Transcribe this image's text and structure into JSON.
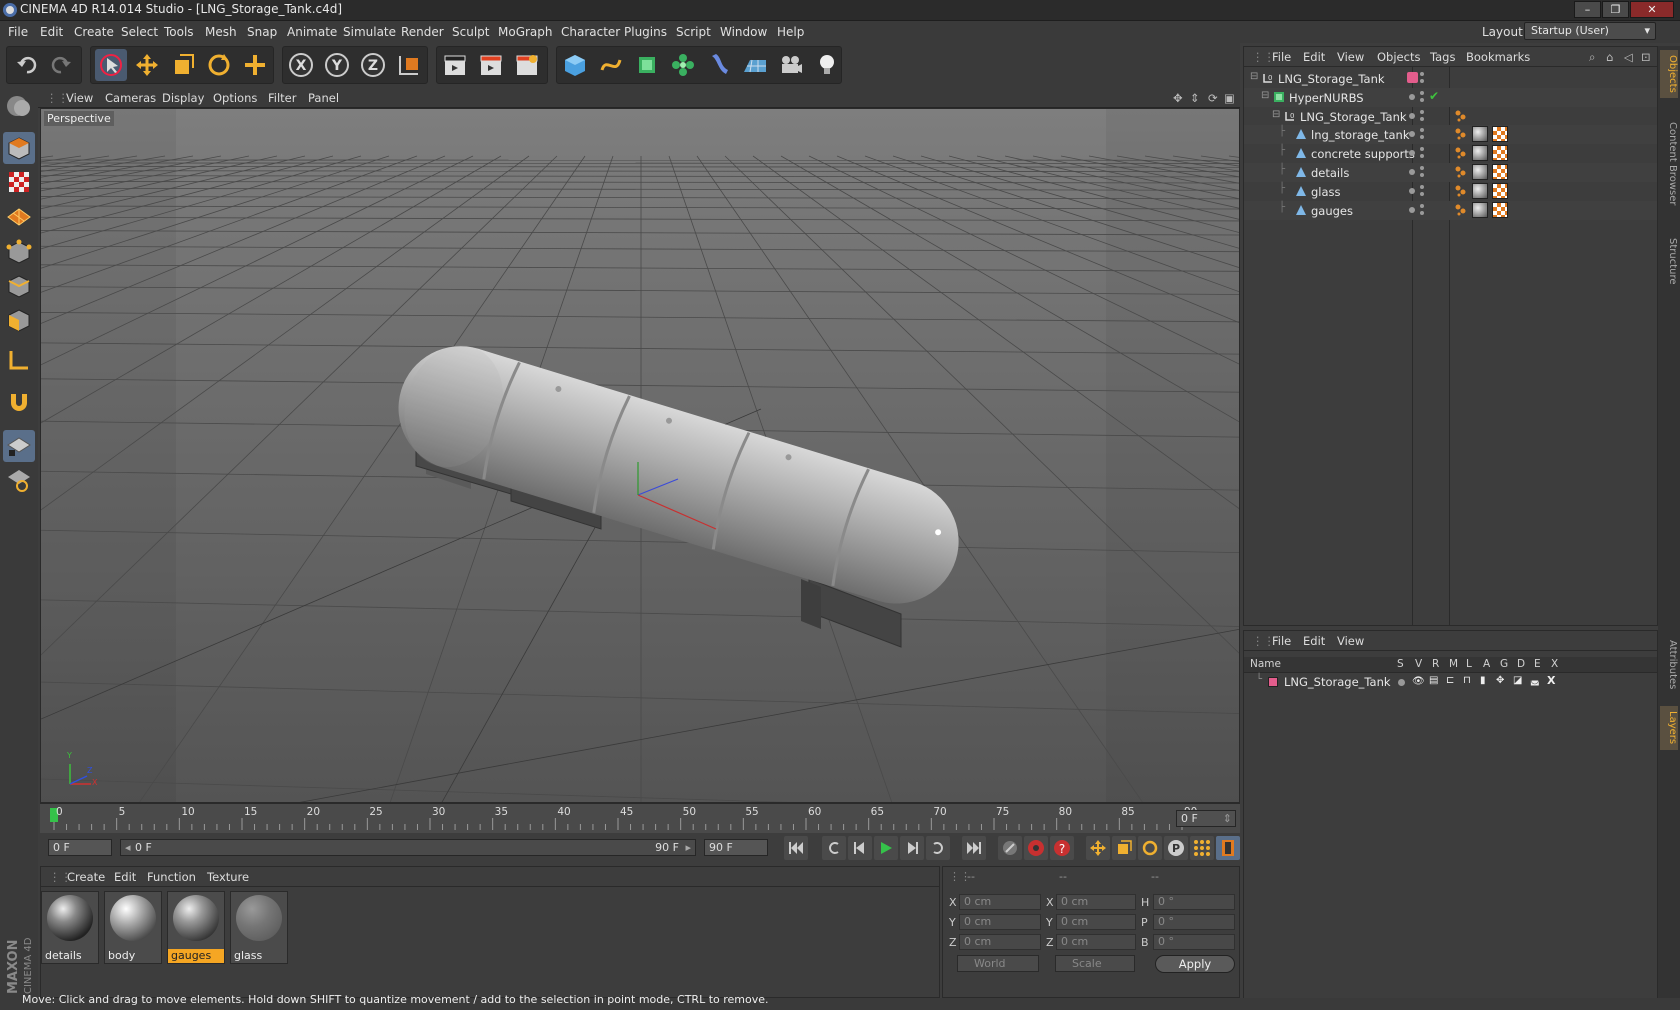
{
  "window": {
    "title": "CINEMA 4D R14.014 Studio - [LNG_Storage_Tank.c4d]",
    "minimize_label": "–",
    "maximize_label": "❐",
    "close_label": "✕"
  },
  "menubar": {
    "items": [
      "File",
      "Edit",
      "Create",
      "Select",
      "Tools",
      "Mesh",
      "Snap",
      "Animate",
      "Simulate",
      "Render",
      "Sculpt",
      "MoGraph",
      "Character",
      "Plugins",
      "Script",
      "Window",
      "Help"
    ],
    "layout_label": "Layout:",
    "layout_value": "Startup (User)"
  },
  "viewport": {
    "menu": [
      "View",
      "Cameras",
      "Display",
      "Options",
      "Filter",
      "Panel"
    ],
    "camera_label": "Perspective",
    "axis_labels": {
      "y": "Y",
      "x": "X",
      "z": "Z"
    }
  },
  "timeline": {
    "ticks": [
      "0",
      "5",
      "10",
      "15",
      "20",
      "25",
      "30",
      "35",
      "40",
      "45",
      "50",
      "55",
      "60",
      "65",
      "70",
      "75",
      "80",
      "85",
      "90"
    ],
    "current_frame": "0 F",
    "start_frame": "0 F",
    "range_start": "0 F",
    "range_end": "90 F",
    "end_frame": "90 F"
  },
  "materials": {
    "menu": [
      "Create",
      "Edit",
      "Function",
      "Texture"
    ],
    "items": [
      {
        "name": "details",
        "selected": false
      },
      {
        "name": "body",
        "selected": false
      },
      {
        "name": "gauges",
        "selected": true
      },
      {
        "name": "glass",
        "selected": false
      }
    ]
  },
  "coordinates": {
    "header": [
      "--",
      "--",
      "--"
    ],
    "rows": [
      {
        "a": "X",
        "av": "0 cm",
        "b": "X",
        "bv": "0 cm",
        "c": "H",
        "cv": "0 °"
      },
      {
        "a": "Y",
        "av": "0 cm",
        "b": "Y",
        "bv": "0 cm",
        "c": "P",
        "cv": "0 °"
      },
      {
        "a": "Z",
        "av": "0 cm",
        "b": "Z",
        "bv": "0 cm",
        "c": "B",
        "cv": "0 °"
      }
    ],
    "mode1": "World",
    "mode2": "Scale",
    "apply_label": "Apply"
  },
  "objects_panel": {
    "menu": [
      "File",
      "Edit",
      "View",
      "Objects",
      "Tags",
      "Bookmarks"
    ],
    "tree": [
      {
        "name": "LNG_Storage_Tank",
        "depth": 0,
        "type": "null"
      },
      {
        "name": "HyperNURBS",
        "depth": 1,
        "type": "nurbs"
      },
      {
        "name": "LNG_Storage_Tank",
        "depth": 2,
        "type": "null"
      },
      {
        "name": "lng_storage_tank",
        "depth": 3,
        "type": "poly"
      },
      {
        "name": "concrete supports",
        "depth": 3,
        "type": "poly"
      },
      {
        "name": "details",
        "depth": 3,
        "type": "poly"
      },
      {
        "name": "glass",
        "depth": 3,
        "type": "poly"
      },
      {
        "name": "gauges",
        "depth": 3,
        "type": "poly"
      }
    ],
    "check_mark": "✔"
  },
  "layers_panel": {
    "menu": [
      "File",
      "Edit",
      "View"
    ],
    "columns": [
      "Name",
      "S",
      "V",
      "R",
      "M",
      "L",
      "A",
      "G",
      "D",
      "E",
      "X"
    ],
    "layers": [
      {
        "name": "LNG_Storage_Tank",
        "color": "#e35d8c"
      }
    ]
  },
  "right_tabs": [
    "Objects",
    "Content Browser",
    "Structure",
    "Attributes",
    "Layers"
  ],
  "brand": {
    "maxon": "MAXON",
    "c4d": "CINEMA 4D"
  },
  "status": "Move: Click and drag to move elements. Hold down SHIFT to quantize movement / add to the selection in point mode, CTRL to remove.",
  "colors": {
    "accent": "#5a6f8a",
    "layer": "#e35d8c",
    "selected_mat": "#f5a623",
    "timeline_marker": "#35c24a"
  }
}
